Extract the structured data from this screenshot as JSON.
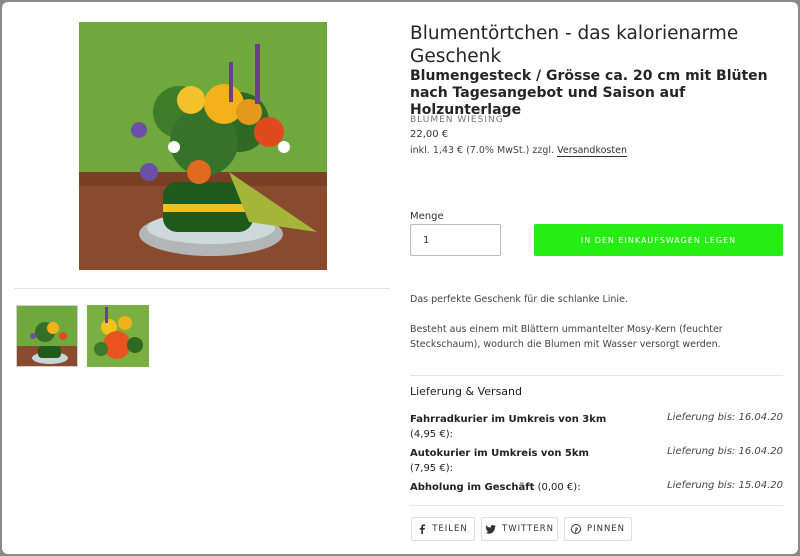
{
  "product": {
    "title": "Blumentörtchen - das kalorienarme Geschenk",
    "subtitle": "Blumengesteck / Grösse ca. 20 cm mit Blüten nach Tagesangebot und Saison auf Holzunterlage",
    "vendor": "BLUMEN WIESING",
    "price": "22,00 €",
    "tax_text": "inkl. 1,43 € (7.0% MwSt.) zzgl.",
    "shipping_link": "Versandkosten"
  },
  "purchase": {
    "quantity_label": "Menge",
    "quantity_value": "1",
    "add_to_cart_label": "IN DEN EINKAUFSWAGEN LEGEN",
    "button_color": "#26ee14"
  },
  "description": {
    "line1": "Das perfekte Geschenk für die schlanke Linie.",
    "line2": "Besteht aus einem mit Blättern ummantelter Mosy-Kern (feuchter Steckschaum), wodurch die Blumen mit Wasser versorgt werden."
  },
  "delivery": {
    "heading": "Lieferung & Versand",
    "options": [
      {
        "name": "Fahrradkurier im Umkreis von 3km",
        "price": "(4,95 €):",
        "date": "Lieferung bis: 16.04.20"
      },
      {
        "name": "Autokurier im Umkreis von 5km",
        "price": "(7,95 €):",
        "date": "Lieferung bis: 16.04.20"
      },
      {
        "name": "Abholung im Geschäft",
        "price": "(0,00 €):",
        "date": "Lieferung bis: 15.04.20"
      }
    ]
  },
  "share": {
    "facebook": "TEILEN",
    "twitter": "TWITTERN",
    "pinterest": "PINNEN",
    "icons": [
      "facebook-icon",
      "twitter-icon",
      "pinterest-icon"
    ]
  }
}
